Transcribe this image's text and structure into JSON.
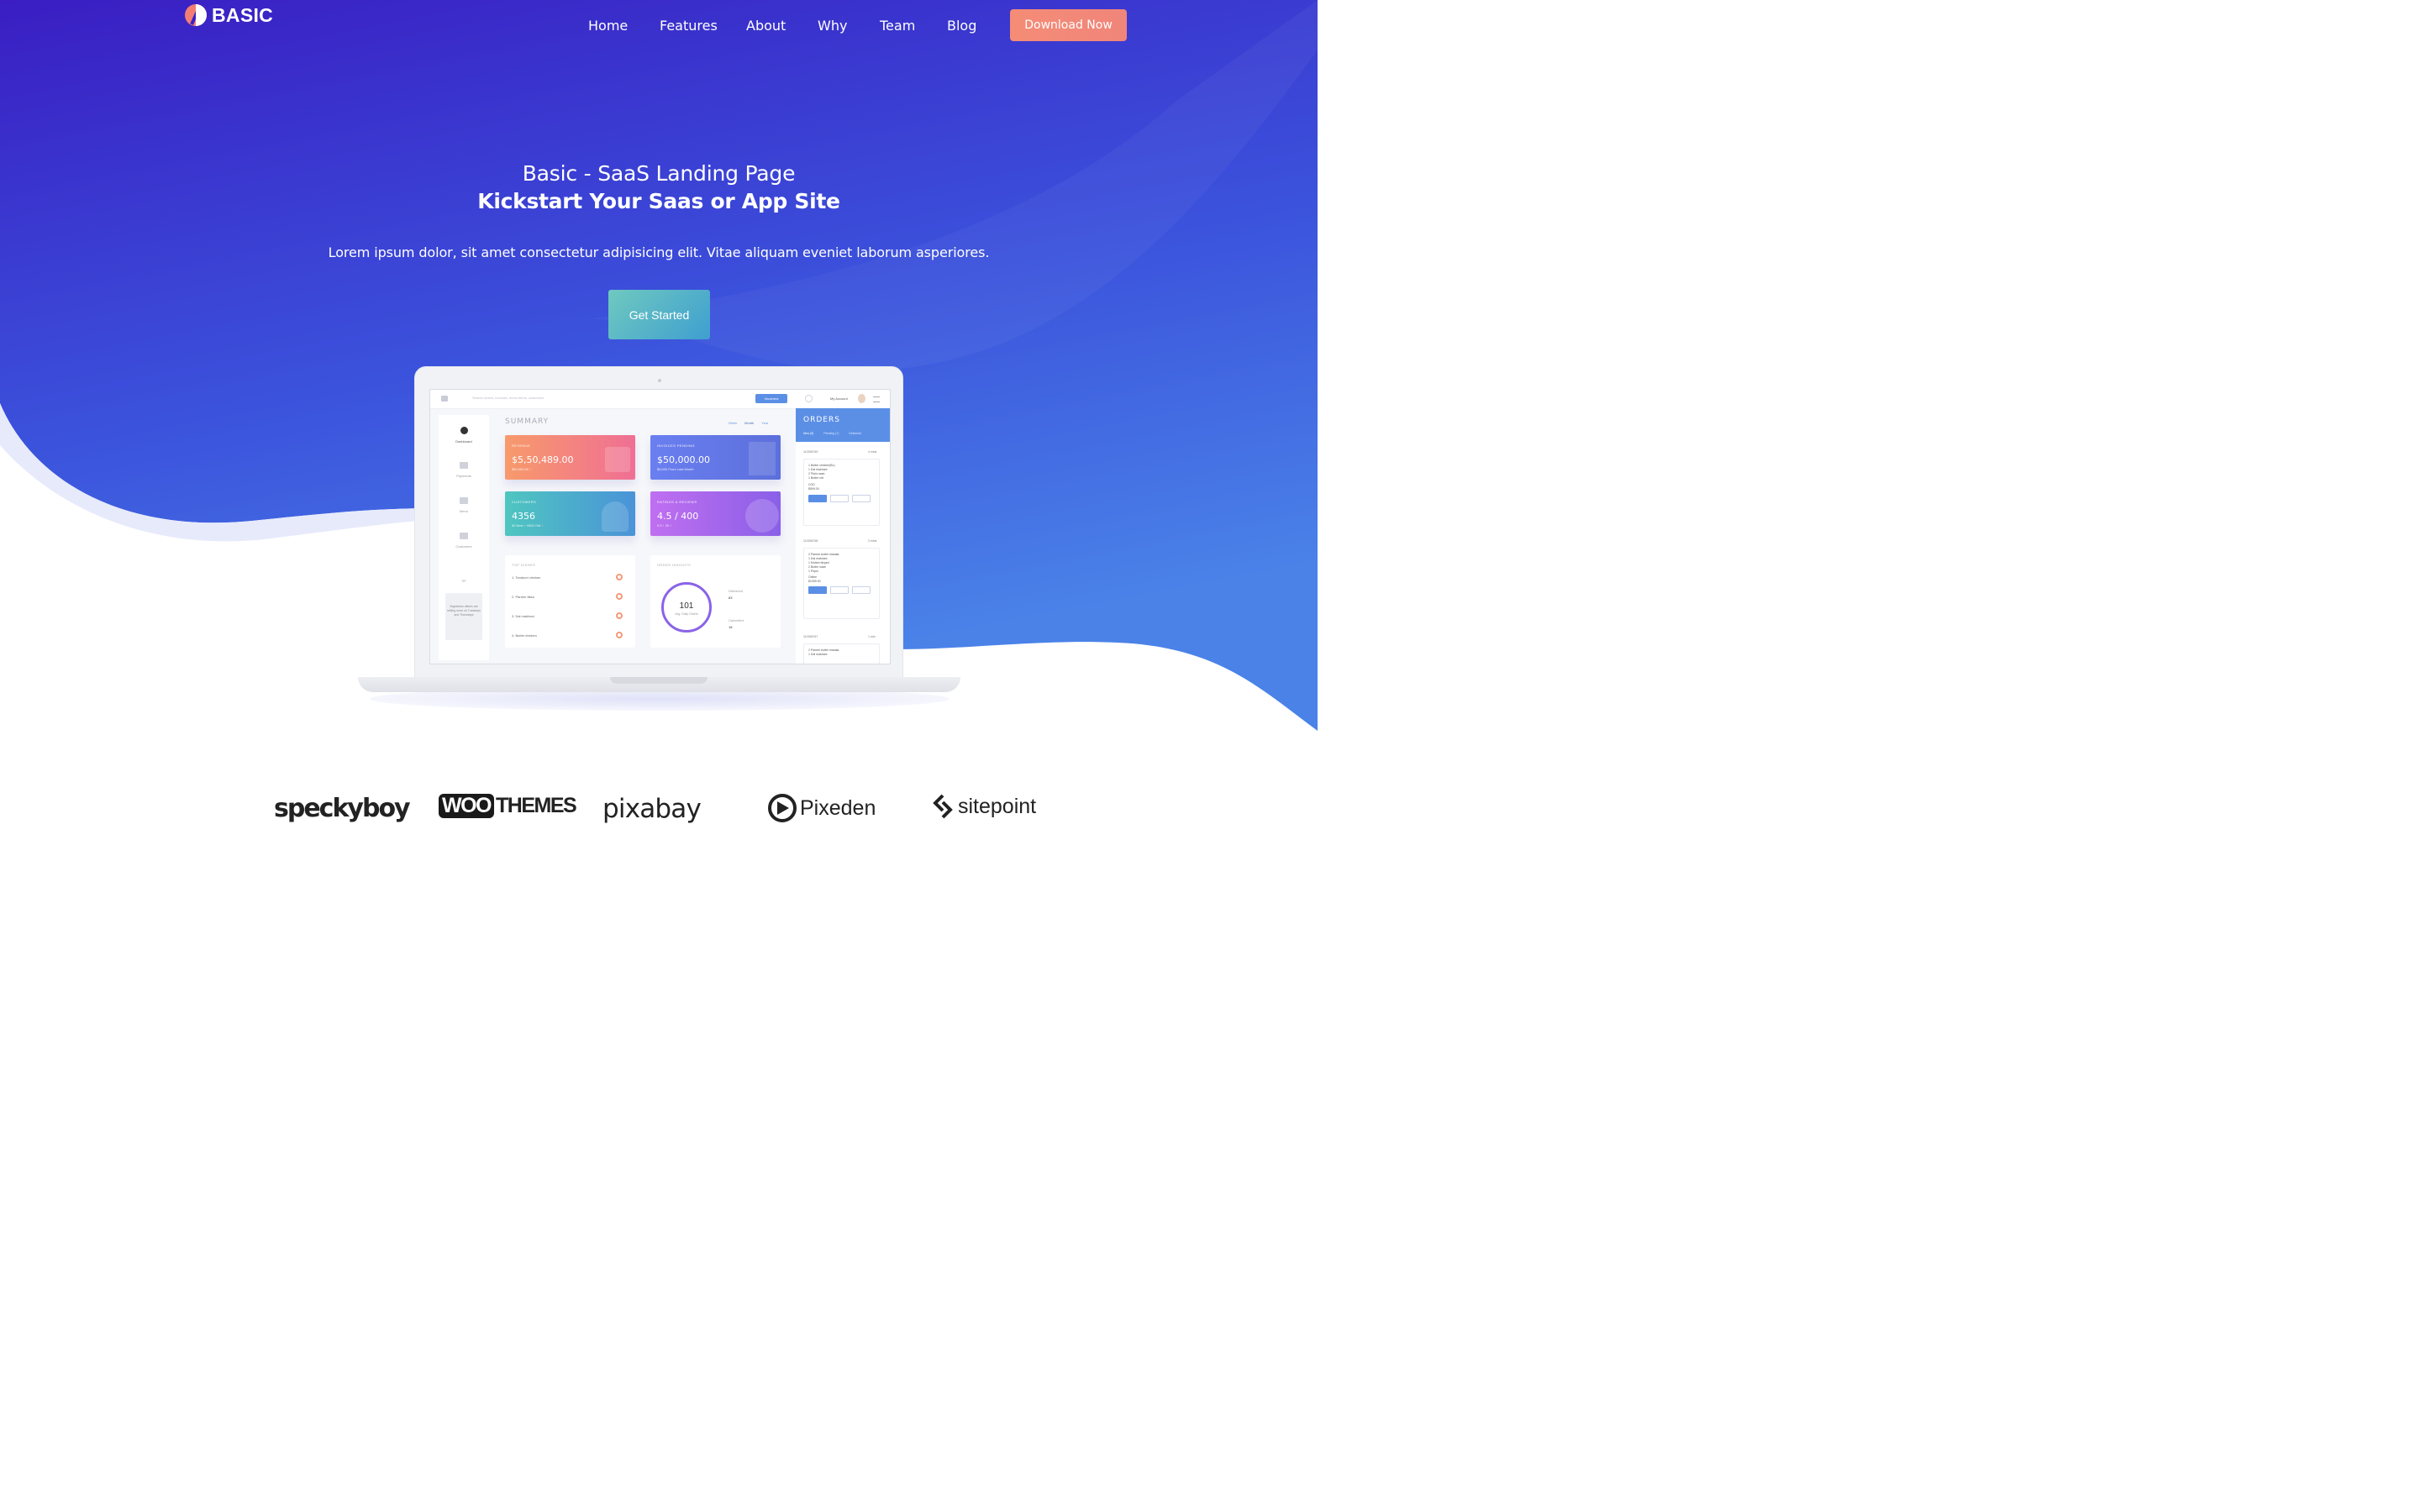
{
  "brand": {
    "name": "BASIC"
  },
  "nav": {
    "items": [
      "Home",
      "Features",
      "About",
      "Why",
      "Team",
      "Blog"
    ],
    "cta": "Download Now"
  },
  "hero": {
    "subtitle": "Basic - SaaS Landing Page",
    "title": "Kickstart Your Saas or App Site",
    "description": "Lorem ipsum dolor, sit amet consectetur adipisicing elit. Vitae aliquam eveniet laborum asperiores.",
    "cta": "Get Started"
  },
  "dashboard": {
    "search_placeholder": "Search orders, invoices, menu items, customers",
    "vouchers": "Vouchers",
    "account": "My Account",
    "sidebar": [
      "Dashboard",
      "Payments",
      "Menu",
      "Customers"
    ],
    "tip_label": "TIP",
    "tip_text": "Vegetarian dishes are selling more on Tuesdays and Thursdays",
    "summary": "SUMMARY",
    "periods": [
      "Week",
      "Month",
      "Year"
    ],
    "cards": [
      {
        "label": "REVENUE",
        "value": "$5,50,489.00",
        "sub": "$50,000.00 ↑"
      },
      {
        "label": "INVOICES PENDING",
        "value": "$50,000.00",
        "sub": "$5,000 From Last Month"
      },
      {
        "label": "CUSTOMERS",
        "value": "4356",
        "sub": "50 New ↑      4300 Old ↑"
      },
      {
        "label": "RATINGS & REVIEWS",
        "value": "4.5 / 400",
        "sub": "0.9 ↑          20 ↑"
      }
    ],
    "top_dishes": {
      "title": "TOP DISHES",
      "items": [
        "1. Tandoori chicken",
        "2. Paneer tikka",
        "3. Dal makhani",
        "4. Butter chicken"
      ]
    },
    "order_insights": {
      "title": "ORDER INSIGHTS",
      "total": "101",
      "total_label": "Avg. Daily Orders",
      "delivered_label": "Delivered",
      "delivered": "83",
      "cancelled_label": "Cancelled",
      "cancelled": "18"
    },
    "orders": {
      "title": "ORDERS",
      "tabs": [
        "New (5)",
        "Pending (7)",
        "Delivered"
      ],
      "list": [
        {
          "id": "110296769",
          "time": "4 mins",
          "items": [
            "1 Butter chicken(BL)",
            "1 Dal makhani",
            "2 Plain naan",
            "1 Butter roti"
          ],
          "payment": "COD",
          "amount": "$599.00"
        },
        {
          "id": "110296768",
          "time": "3 mins",
          "items": [
            "2 Paneer butter masala",
            "1 Dal makhani",
            "1 Mutton biryani",
            "2 Butter naan",
            "1 Pepsi"
          ],
          "payment": "Online",
          "amount": "$1399.00"
        },
        {
          "id": "110296767",
          "time": "1 min",
          "items": [
            "2 Paneer butter masala",
            "1 Dal makhani"
          ]
        }
      ]
    }
  },
  "partners": [
    "speckyboy",
    "WOO",
    "THEMES",
    "pixabay",
    "Pixeden",
    "sitepoint"
  ],
  "colors": {
    "hero_gradient_start": "#3a1fc4",
    "hero_gradient_end": "#4a7ee6",
    "cta_orange": "#f58c76",
    "cta_teal": "#5cb8c9"
  }
}
